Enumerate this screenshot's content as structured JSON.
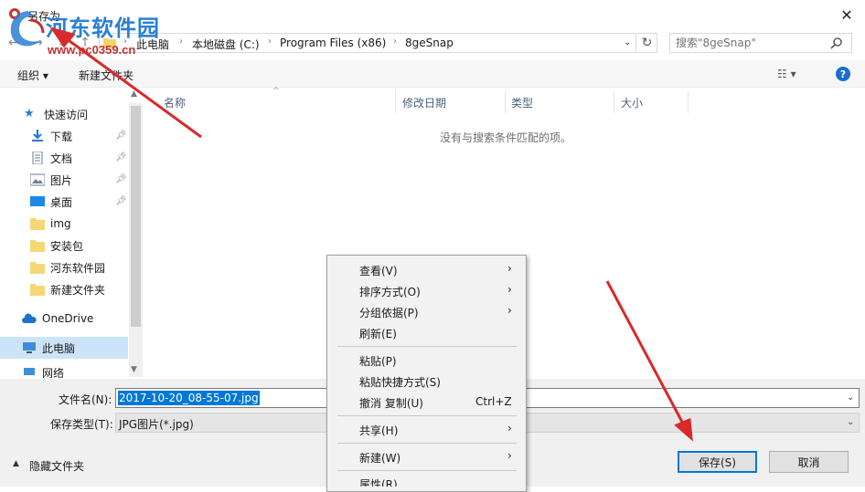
{
  "window": {
    "title": "另存为",
    "close_glyph": "✕"
  },
  "address": {
    "crumbs": [
      "此电脑",
      "本地磁盘 (C:)",
      "Program Files (x86)",
      "8geSnap"
    ],
    "refresh_glyph": "↻",
    "search_placeholder": "搜索\"8geSnap\""
  },
  "toolbar": {
    "organize": "组织 ▾",
    "new_folder": "新建文件夹",
    "view_glyph": "☷ ▾",
    "help": "?"
  },
  "nav": {
    "items": [
      {
        "label": "快速访问",
        "icon": "star-icon"
      },
      {
        "label": "下载",
        "icon": "download-icon",
        "pinned": true
      },
      {
        "label": "文档",
        "icon": "document-icon",
        "pinned": true
      },
      {
        "label": "图片",
        "icon": "picture-icon",
        "pinned": true
      },
      {
        "label": "桌面",
        "icon": "desktop-icon",
        "pinned": true
      },
      {
        "label": "img",
        "icon": "folder-icon"
      },
      {
        "label": "安装包",
        "icon": "folder-icon"
      },
      {
        "label": "河东软件园",
        "icon": "folder-icon"
      },
      {
        "label": "新建文件夹",
        "icon": "folder-icon"
      },
      {
        "label": "OneDrive",
        "icon": "cloud-icon"
      },
      {
        "label": "此电脑",
        "icon": "computer-icon"
      },
      {
        "label": "网络",
        "icon": "network-icon"
      }
    ]
  },
  "columns": {
    "name": "名称",
    "modified": "修改日期",
    "type": "类型",
    "size": "大小"
  },
  "content": {
    "empty_message": "没有与搜索条件匹配的项。"
  },
  "form": {
    "filename_label": "文件名(N):",
    "filename_value": "2017-10-20_08-55-07.jpg",
    "filetype_label": "保存类型(T):",
    "filetype_value": "JPG图片(*.jpg)",
    "hide_folders": "隐藏文件夹",
    "save": "保存(S)",
    "cancel": "取消"
  },
  "context_menu": {
    "items": [
      {
        "label": "查看(V)",
        "submenu": true
      },
      {
        "label": "排序方式(O)",
        "submenu": true
      },
      {
        "label": "分组依据(P)",
        "submenu": true
      },
      {
        "label": "刷新(E)"
      },
      {
        "label": "粘贴(P)"
      },
      {
        "label": "粘贴快捷方式(S)"
      },
      {
        "label": "撤消 复制(U)",
        "shortcut": "Ctrl+Z"
      },
      {
        "label": "共享(H)",
        "submenu": true
      },
      {
        "label": "新建(W)",
        "submenu": true
      },
      {
        "label": "属性(R)"
      }
    ]
  },
  "watermark": {
    "text": "河东软件园",
    "url": "www.pc0359.cn"
  },
  "colors": {
    "accent": "#0078d7",
    "annotation_arrow": "#d82a2a",
    "watermark_blue": "#2a7fd4"
  }
}
